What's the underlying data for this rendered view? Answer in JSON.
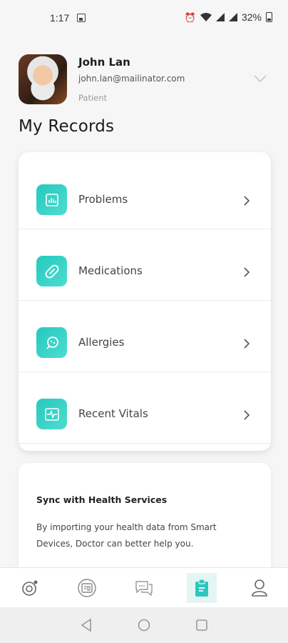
{
  "status_bar": {
    "time": "1:17",
    "battery": "32%"
  },
  "profile": {
    "name": "John Lan",
    "email": "john.lan@mailinator.com",
    "role": "Patient"
  },
  "page": {
    "title": "My Records"
  },
  "records": {
    "items": [
      {
        "label": "Problems",
        "icon": "chart-icon"
      },
      {
        "label": "Medications",
        "icon": "pill-icon"
      },
      {
        "label": "Allergies",
        "icon": "allergy-icon"
      },
      {
        "label": "Recent Vitals",
        "icon": "vitals-icon"
      }
    ]
  },
  "sync": {
    "title": "Sync with Health Services",
    "text": "By importing your health data from Smart Devices, Doctor can better help you."
  },
  "tabs": [
    {
      "name": "dashboard",
      "icon": "target-icon"
    },
    {
      "name": "appointments",
      "icon": "id-card-icon"
    },
    {
      "name": "chat",
      "icon": "chat-icon"
    },
    {
      "name": "records",
      "icon": "clipboard-icon",
      "active": true
    },
    {
      "name": "profile",
      "icon": "user-icon"
    }
  ],
  "colors": {
    "accent": "#2cc8be",
    "background": "#f6f6f6"
  }
}
